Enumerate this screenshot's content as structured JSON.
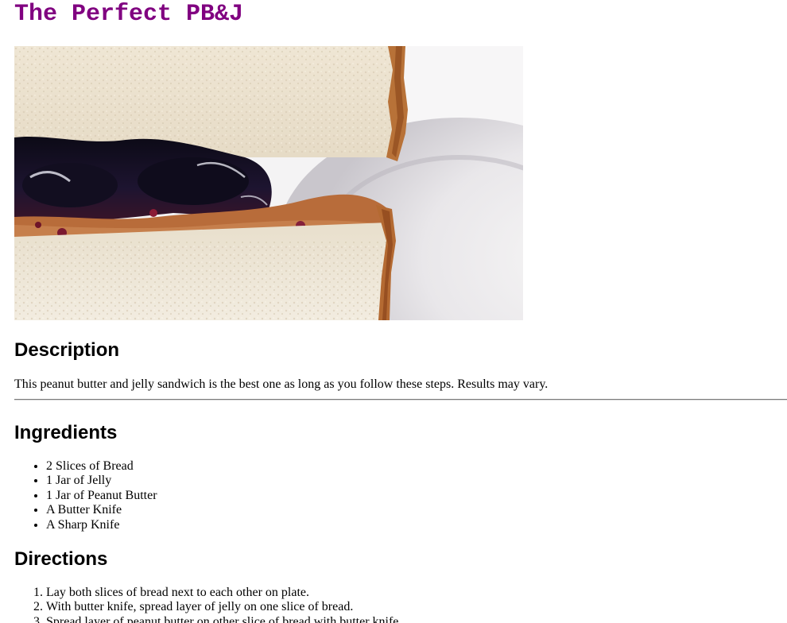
{
  "title": "The Perfect PB&J",
  "hero_image": {
    "subject": "peanut butter and jelly sandwich on a plate"
  },
  "description": {
    "heading": "Description",
    "text": "This peanut butter and jelly sandwich is the best one as long as you follow these steps. Results may vary."
  },
  "ingredients": {
    "heading": "Ingredients",
    "items": [
      "2 Slices of Bread",
      "1 Jar of Jelly",
      "1 Jar of Peanut Butter",
      "A Butter Knife",
      "A Sharp Knife"
    ]
  },
  "directions": {
    "heading": "Directions",
    "steps": [
      "Lay both slices of bread next to each other on plate.",
      "With butter knife, spread layer of jelly on one slice of bread.",
      "Spread layer of peanut butter on other slice of bread with butter knife."
    ]
  },
  "colors": {
    "title": "#800080",
    "rule": "#7a7a7a"
  }
}
